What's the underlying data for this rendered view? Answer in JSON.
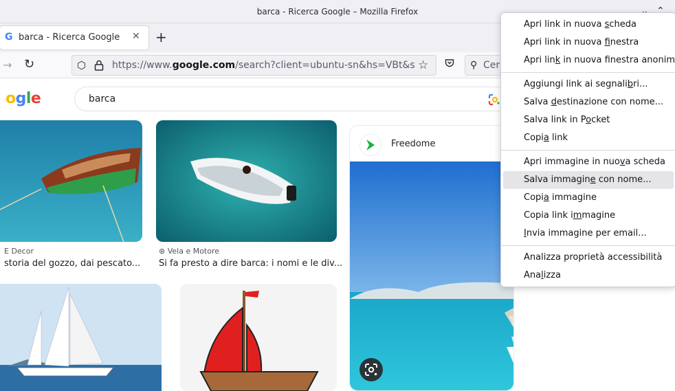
{
  "window": {
    "title": "barca - Ricerca Google – Mozilla Firefox"
  },
  "tab": {
    "label": "barca - Ricerca Google",
    "favicon": "G"
  },
  "navbar": {
    "url_prefix": "https://www.",
    "url_domain": "google.com",
    "url_rest": "/search?client=ubuntu-sn&hs=VBt&sca_esv",
    "search_placeholder": "Cer"
  },
  "google": {
    "query": "barca",
    "logo_colors": [
      "#4285f4",
      "#ea4335",
      "#fbbc05",
      "#4285f4",
      "#34a853",
      "#ea4335"
    ]
  },
  "results": [
    {
      "source": "E Decor",
      "caption": "storia del gozzo, dai pescato..."
    },
    {
      "source": "Vela e Motore",
      "caption": "Si fa presto a dire barca: i nomi e le div..."
    },
    {
      "source": "Freedome",
      "caption": ""
    }
  ],
  "context_menu": {
    "groups": [
      [
        {
          "label": "Apri link in nuova scheda",
          "key": "s"
        },
        {
          "label": "Apri link in nuova finestra",
          "key": "f"
        },
        {
          "label": "Apri link in nuova finestra anonima",
          "key": "k"
        }
      ],
      [
        {
          "label": "Aggiungi link ai segnalibri...",
          "key": "b"
        },
        {
          "label": "Salva destinazione con nome...",
          "key": "d"
        },
        {
          "label": "Salva link in Pocket",
          "key": "o"
        },
        {
          "label": "Copia link",
          "key": "a"
        }
      ],
      [
        {
          "label": "Apri immagine in nuova scheda",
          "key": "v"
        },
        {
          "label": "Salva immagine con nome...",
          "key": "e",
          "highlighted": true
        },
        {
          "label": "Copia immagine",
          "key": "a"
        },
        {
          "label": "Copia link immagine",
          "key": "m"
        },
        {
          "label": "Invia immagine per email...",
          "key": "I"
        }
      ],
      [
        {
          "label": "Analizza proprietà accessibilità",
          "key": ""
        },
        {
          "label": "Analizza",
          "key": "l"
        }
      ]
    ]
  }
}
